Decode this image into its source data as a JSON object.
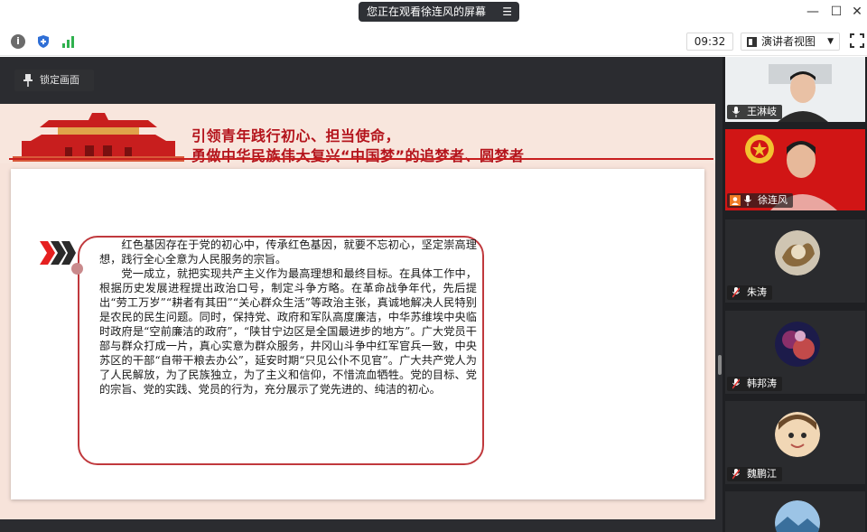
{
  "window": {
    "share_banner": "您正在观看徐连风的屏幕",
    "menu_icon": "list-icon"
  },
  "toolbar": {
    "time": "09:32",
    "view_mode": "演讲者视图",
    "icons": [
      "info-icon",
      "shield-icon",
      "signal-icon",
      "fullscreen-icon"
    ]
  },
  "main": {
    "lock_label": "锁定画面"
  },
  "slide": {
    "title_line1": "引领青年践行初心、担当使命，",
    "title_line2": "勇做中华民族伟大复兴“中国梦”的追梦者、圆梦者",
    "paragraph1": "红色基因存在于党的初心中，传承红色基因，就要不忘初心，坚定崇高理想，践行全心全意为人民服务的宗旨。",
    "paragraph2": "党一成立，就把实现共产主义作为最高理想和最终目标。在具体工作中，根据历史发展进程提出政治口号，制定斗争方略。在革命战争年代，先后提出“劳工万岁”“耕者有其田”“关心群众生活”等政治主张，真诚地解决人民特别是农民的民生问题。同时，保持党、政府和军队高度廉洁，中华苏维埃中央临时政府是“空前廉洁的政府”，“陕甘宁边区是全国最进步的地方”。广大党员干部与群众打成一片，真心实意为群众服务，井冈山斗争中红军官兵一致，中央苏区的干部“自带干粮去办公”，延安时期“只见公仆不见官”。广大共产党人为了人民解放，为了民族独立，为了主义和信仰，不惜流血牺牲。党的目标、党的宗旨、党的实践、党员的行为，充分展示了党先进的、纯洁的初心。"
  },
  "participants": [
    {
      "name": "王淋岐",
      "active": true
    },
    {
      "name": "徐连风",
      "active": false
    },
    {
      "name": "朱涛",
      "active": false
    },
    {
      "name": "韩邦涛",
      "active": false
    },
    {
      "name": "魏鹏江",
      "active": false
    }
  ],
  "colors": {
    "accent_red": "#c81e1e",
    "title_red": "#b4141c",
    "active_green": "#2fb14e"
  }
}
